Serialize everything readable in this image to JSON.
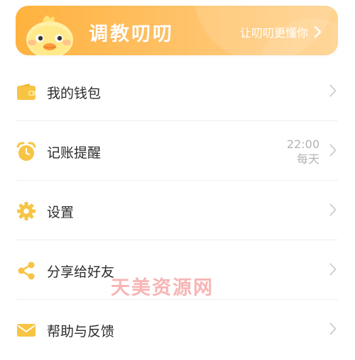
{
  "banner": {
    "title": "调教叨叨",
    "link_label": "让叨叨更懂你",
    "mascot_icon": "duck-mascot-icon",
    "arrow_icon": "chevron-right-icon"
  },
  "menu": {
    "items": [
      {
        "label": "我的钱包",
        "icon": "wallet-icon"
      },
      {
        "label": "记账提醒",
        "icon": "alarm-clock-icon",
        "time": "22:00",
        "frequency": "每天"
      },
      {
        "label": "设置",
        "icon": "gear-icon"
      },
      {
        "label": "分享给好友",
        "icon": "share-icon"
      },
      {
        "label": "帮助与反馈",
        "icon": "mail-icon"
      }
    ]
  },
  "watermark": {
    "text": "天美资源网"
  },
  "colors": {
    "accent": "#ffb23e",
    "icon": "#f7c444",
    "secondary_text": "#b3b3b3",
    "divider": "#efefef"
  }
}
